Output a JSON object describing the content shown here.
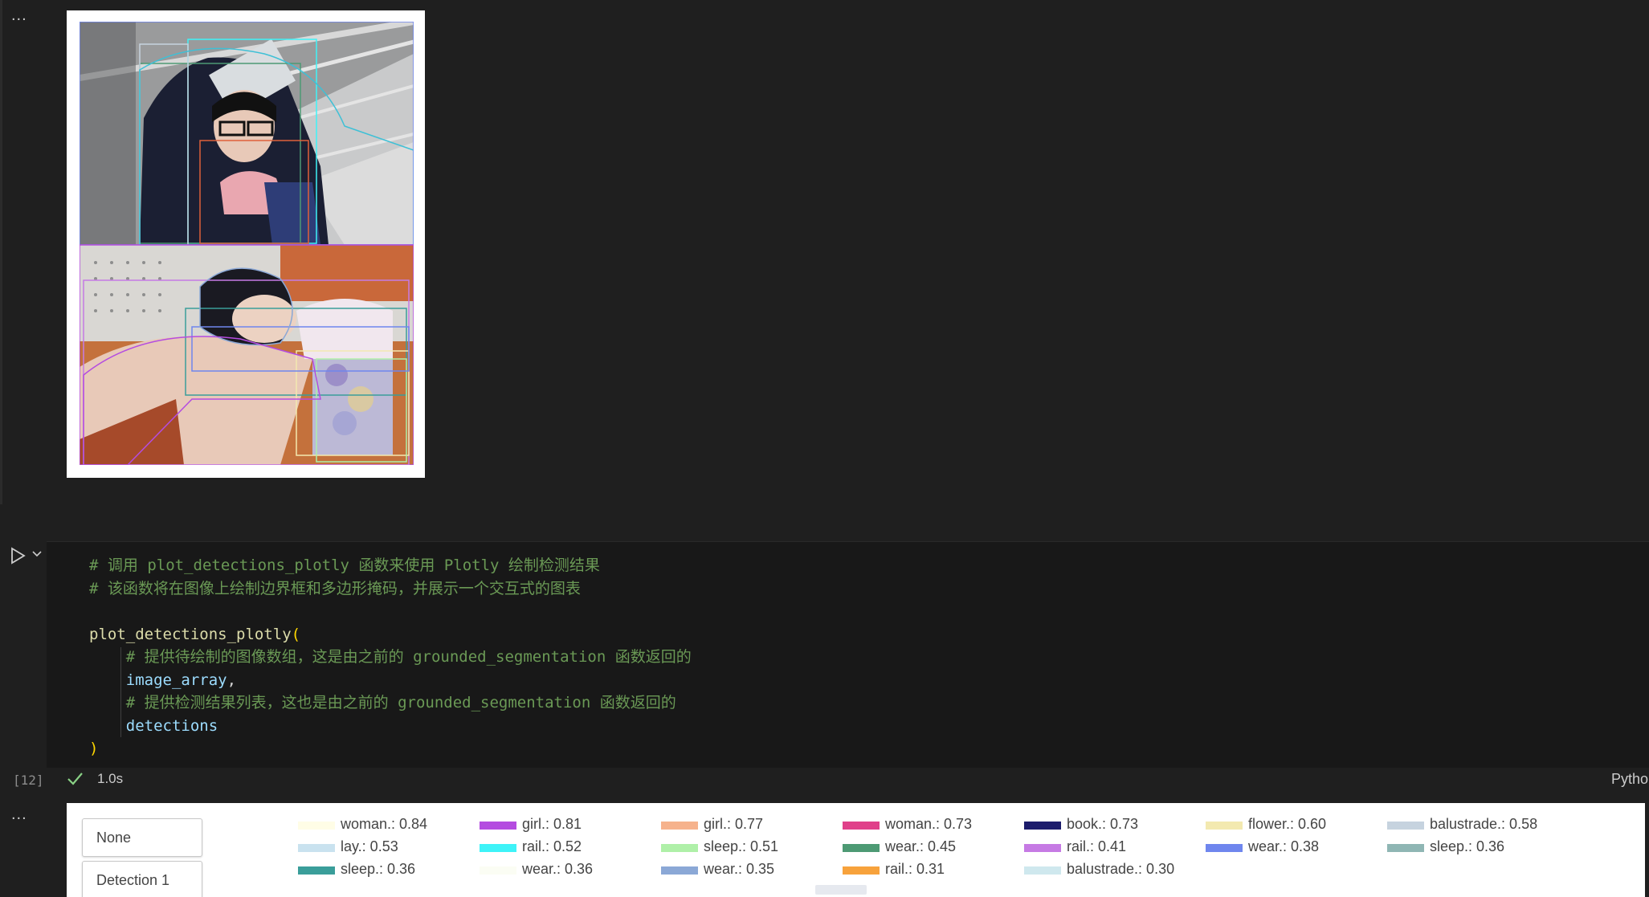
{
  "output_top": {
    "ellipsis": "..."
  },
  "code_cell": {
    "lines": [
      {
        "kind": "comment",
        "text": "# 调用 plot_detections_plotly 函数来使用 Plotly 绘制检测结果"
      },
      {
        "kind": "comment",
        "text": "# 该函数将在图像上绘制边界框和多边形掩码，并展示一个交互式的图表"
      },
      {
        "kind": "blank",
        "text": ""
      },
      {
        "kind": "call",
        "fn": "plot_detections_plotly",
        "paren": "("
      },
      {
        "kind": "comment-indent",
        "text": "    # 提供待绘制的图像数组，这是由之前的 grounded_segmentation 函数返回的"
      },
      {
        "kind": "var-indent",
        "text": "image_array",
        "punct": ","
      },
      {
        "kind": "comment-indent",
        "text": "    # 提供检测结果列表，这也是由之前的 grounded_segmentation 函数返回的"
      },
      {
        "kind": "var-indent",
        "text": "detections",
        "punct": ""
      },
      {
        "kind": "close",
        "paren": ")"
      }
    ],
    "exec_count": "[12]",
    "duration": "1.0s",
    "kernel": "Pytho"
  },
  "output_bottom": {
    "ellipsis": "..."
  },
  "plot": {
    "buttons": [
      "None",
      "Detection 1"
    ],
    "legend": [
      {
        "label": "woman.: 0.84",
        "color": "#fffde6"
      },
      {
        "label": "girl.: 0.81",
        "color": "#b44ce0"
      },
      {
        "label": "girl.: 0.77",
        "color": "#f6b28c"
      },
      {
        "label": "woman.: 0.73",
        "color": "#e0408a"
      },
      {
        "label": "book.: 0.73",
        "color": "#1c1c6c"
      },
      {
        "label": "flower.: 0.60",
        "color": "#f3e9b0"
      },
      {
        "label": "balustrade.: 0.58",
        "color": "#c6d3df"
      },
      {
        "label": "lay.: 0.53",
        "color": "#c9e2ef"
      },
      {
        "label": "rail.: 0.52",
        "color": "#3ef3f8"
      },
      {
        "label": "sleep.: 0.51",
        "color": "#aff0a8"
      },
      {
        "label": "wear.: 0.45",
        "color": "#4d9a74"
      },
      {
        "label": "rail.: 0.41",
        "color": "#c67ae4"
      },
      {
        "label": "wear.: 0.38",
        "color": "#6f86ee"
      },
      {
        "label": "sleep.: 0.36",
        "color": "#8fb6b4"
      },
      {
        "label": "sleep.: 0.36",
        "color": "#3a9e9a"
      },
      {
        "label": "wear.: 0.36",
        "color": "#fbfdf4"
      },
      {
        "label": "wear.: 0.35",
        "color": "#8ba8d6"
      },
      {
        "label": "rail.: 0.31",
        "color": "#f7a23c"
      },
      {
        "label": "balustrade.: 0.30",
        "color": "#cfe8ee"
      }
    ]
  }
}
